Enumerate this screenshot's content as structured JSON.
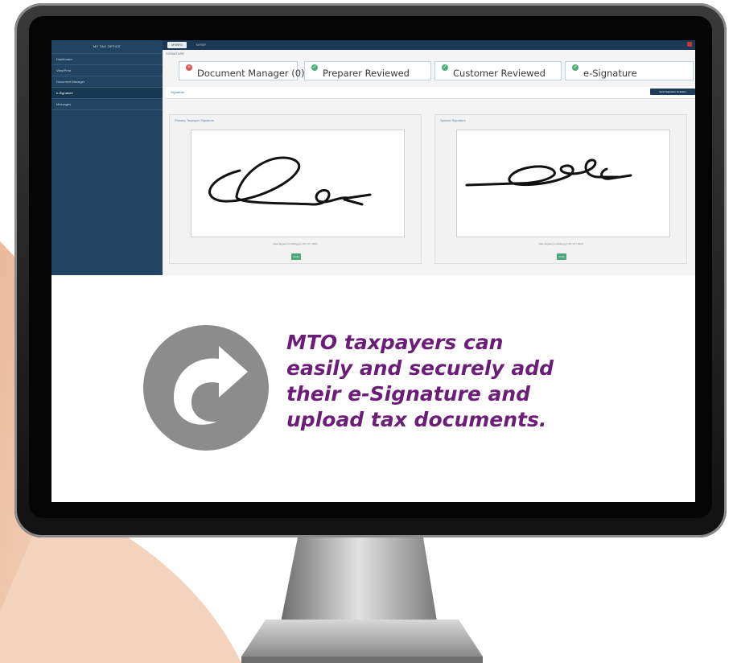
{
  "app": {
    "brand": "MY TAX OFFICE",
    "sidebar_items": [
      "Dashboard",
      "View/Print",
      "Document Manager",
      "e-Signature",
      "Messages"
    ],
    "tabs": [
      "MYINFO",
      "MYREF"
    ],
    "breadcrumb": "SIGNATURE",
    "steps": [
      {
        "label": "Document Manager (0)",
        "status": "error"
      },
      {
        "label": "Preparer Reviewed",
        "status": "done"
      },
      {
        "label": "Customer Reviewed",
        "status": "done"
      },
      {
        "label": "e-Signature",
        "status": "done"
      }
    ],
    "signature_section_label": "Signature",
    "signature_action_button": "Send Signature Invitation",
    "cards": [
      {
        "title": "Primary Taxpayer Signature",
        "date": "Date Signed (mm/dd/yyyy): 03 / 07 / 2023",
        "verify_label": "Verify"
      },
      {
        "title": "Spouse Signature",
        "date": "Date Signed (mm/dd/yyyy): 03 / 07 / 2023",
        "verify_label": "Verify"
      }
    ]
  },
  "marketing": {
    "line1": "MTO taxpayers can",
    "line2": "easily and securely add",
    "line3": "their e-Signature and",
    "line4": "upload tax documents."
  },
  "colors": {
    "accent_text": "#6b1d78",
    "sidebar": "#214463",
    "status_error": "#e25555",
    "status_done": "#4cae74",
    "arrow_icon": "#8c8c8c"
  },
  "icons": [
    "circular-arrow-icon",
    "error-status-icon",
    "check-status-icon"
  ]
}
